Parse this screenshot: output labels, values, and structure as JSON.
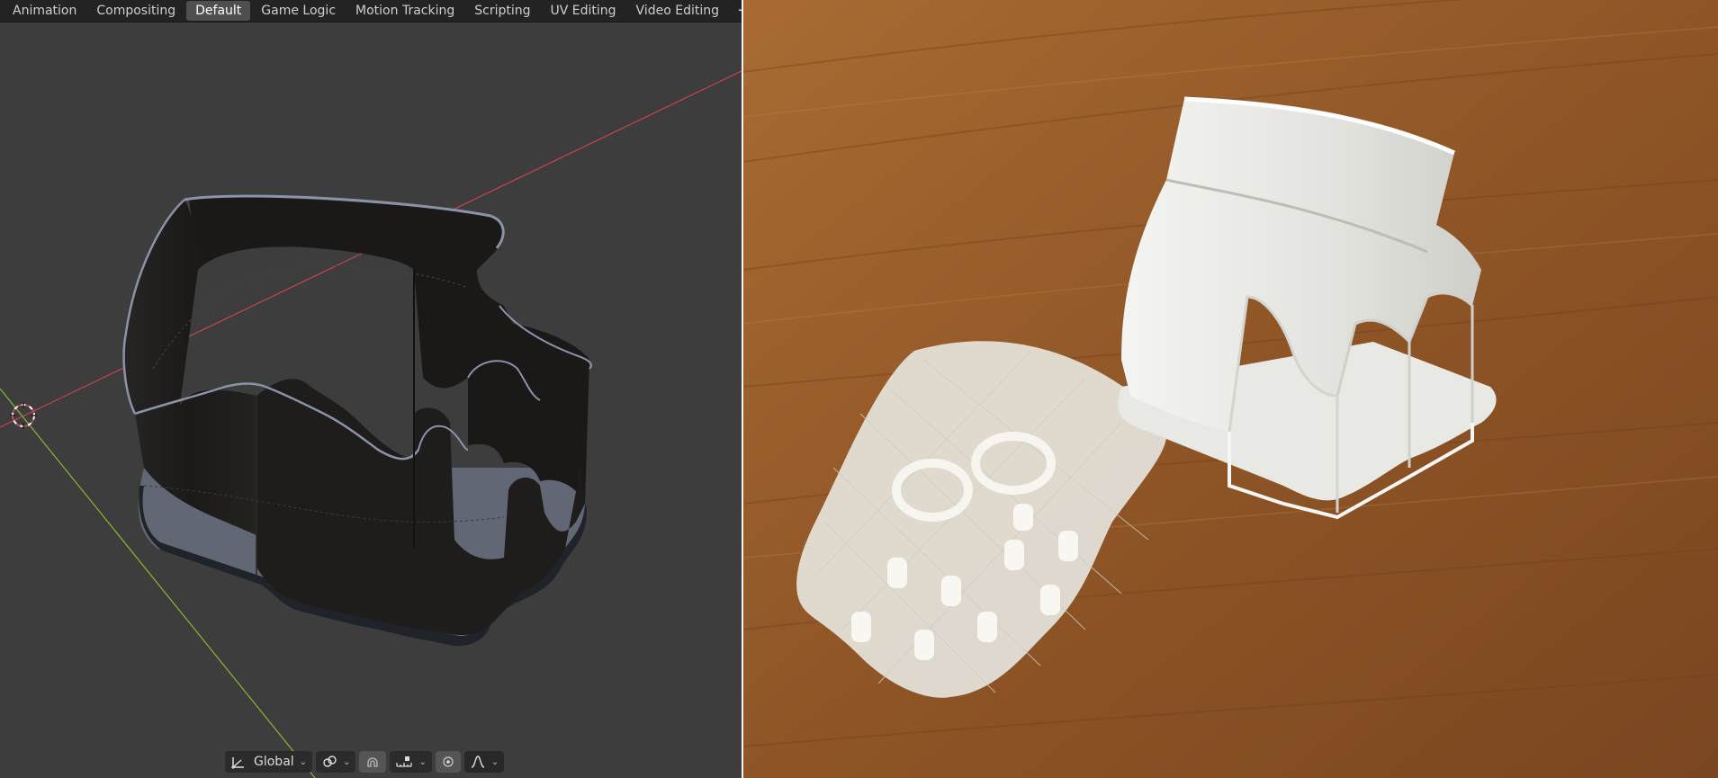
{
  "workspace_tabs": [
    {
      "label": "Animation",
      "active": false
    },
    {
      "label": "Compositing",
      "active": false
    },
    {
      "label": "Default",
      "active": true
    },
    {
      "label": "Game Logic",
      "active": false
    },
    {
      "label": "Motion Tracking",
      "active": false
    },
    {
      "label": "Scripting",
      "active": false
    },
    {
      "label": "UV Editing",
      "active": false
    },
    {
      "label": "Video Editing",
      "active": false
    }
  ],
  "add_tab_label": "+",
  "viewport_header": {
    "orientation_value": "Global",
    "pivot_icon": "pivot-icon",
    "snap_icon": "magnet-icon",
    "snap_target_icon": "snap-increment-icon",
    "proportional_icon": "proportional-edit-icon",
    "falloff_icon": "falloff-curve-icon"
  },
  "colors": {
    "viewport_bg": "#3d3d3d",
    "x_axis": "#c8424f",
    "y_axis": "#8ab633",
    "model_dark": "#1f1f1f",
    "model_edge": "#8a93a8",
    "wood": "#a0662e"
  }
}
